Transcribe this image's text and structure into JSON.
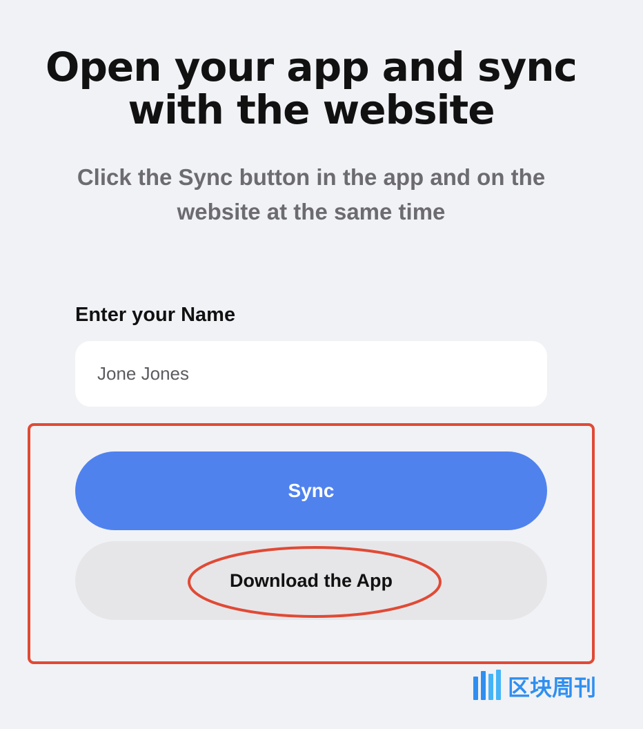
{
  "heading": "Open your app and sync with the website",
  "subtitle": "Click the Sync button in the app and on the website at the same time",
  "name_field": {
    "label": "Enter your Name",
    "value": "Jone Jones"
  },
  "buttons": {
    "sync_label": "Sync",
    "download_label": "Download the App"
  },
  "watermark": {
    "text": "区块周刊"
  },
  "colors": {
    "background": "#f1f2f6",
    "sync_button": "#5082ee",
    "download_button": "#e6e6e9",
    "annotation": "#e04a35",
    "watermark": "#2f8ff0"
  }
}
